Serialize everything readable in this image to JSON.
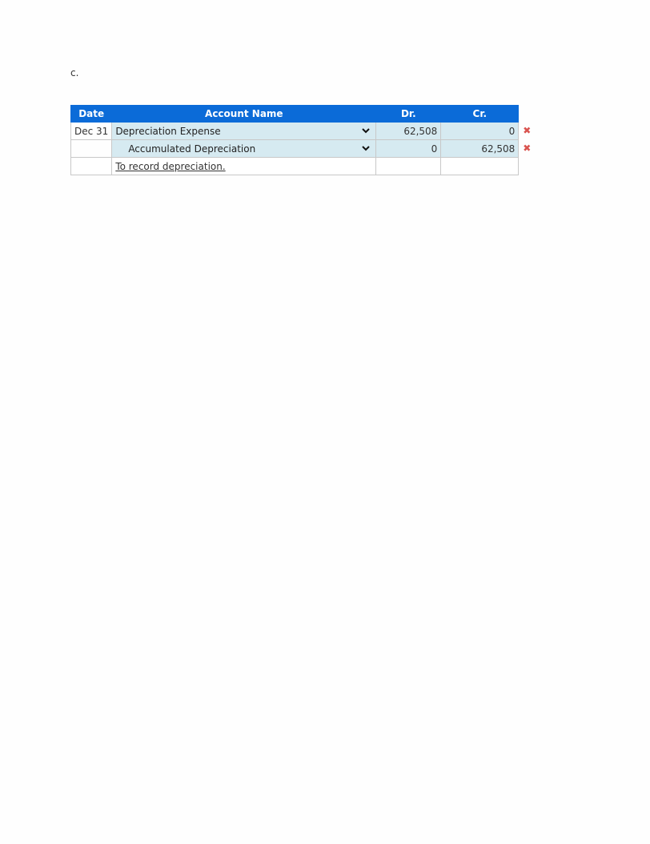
{
  "part_label": "c.",
  "table": {
    "headers": {
      "date": "Date",
      "account": "Account Name",
      "dr": "Dr.",
      "cr": "Cr."
    },
    "rows": [
      {
        "date": "Dec 31",
        "account": "Depreciation Expense",
        "dr": "62,508",
        "cr": "0",
        "indent": false,
        "status_icon": "x-mark-icon"
      },
      {
        "date": "",
        "account": "Accumulated Depreciation",
        "dr": "0",
        "cr": "62,508",
        "indent": true,
        "status_icon": "x-mark-icon"
      }
    ],
    "memo": "To record depreciation.",
    "status_color": "#d9534f",
    "header_color": "#0b6bd8",
    "input_bg_color": "#d6eaf1"
  },
  "icons": {
    "dropdown": "chevron-down-icon",
    "incorrect": "✖"
  }
}
